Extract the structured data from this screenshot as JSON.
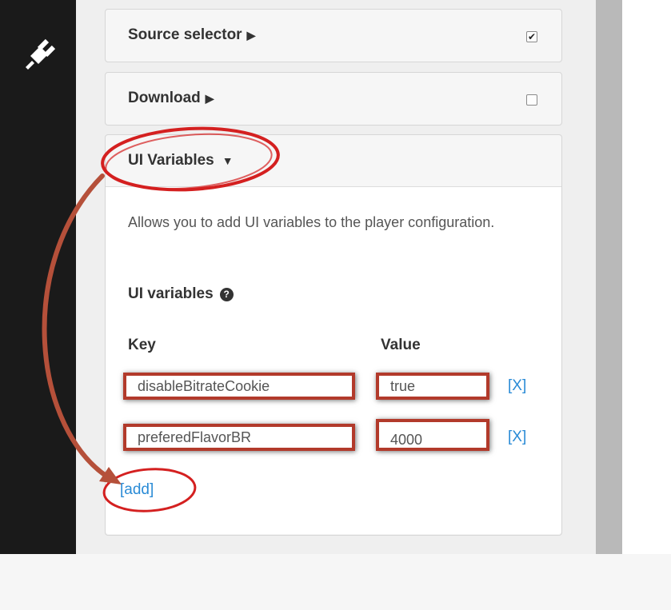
{
  "sidebar": {
    "icon": "plug-icon"
  },
  "panels": [
    {
      "title": "Source selector",
      "arrow": "▶",
      "checked": true,
      "check_glyph": "✔"
    },
    {
      "title": "Download",
      "arrow": "▶",
      "checked": false,
      "check_glyph": ""
    }
  ],
  "ui_variables": {
    "title": "UI Variables",
    "arrow": "▼",
    "description": "Allows you to add UI variables to the player configuration.",
    "section_label": "UI variables",
    "help_glyph": "?",
    "key_header": "Key",
    "value_header": "Value",
    "rows": [
      {
        "key": "disableBitrateCookie",
        "value": "true",
        "remove": "[X]"
      },
      {
        "key": "preferedFlavorBR",
        "value": "4000",
        "remove": "[X]"
      }
    ],
    "add_label": "[add]"
  },
  "colors": {
    "annotation_red": "#d42020",
    "box_red": "#b23a2b",
    "arrow_brown": "#b5503a",
    "link_blue": "#2a8bd6"
  }
}
